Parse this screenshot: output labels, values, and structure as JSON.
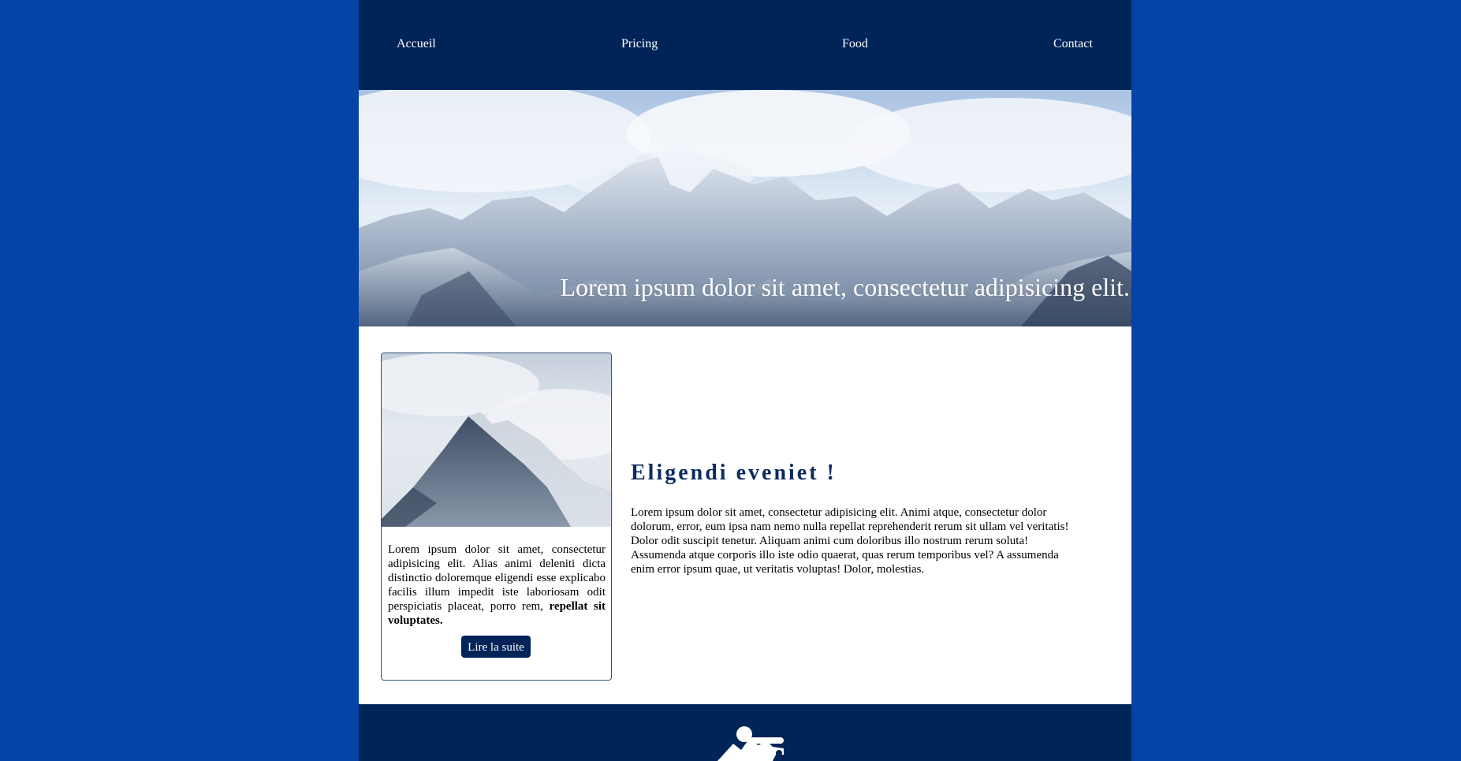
{
  "nav": {
    "items": [
      {
        "label": "Accueil"
      },
      {
        "label": "Pricing"
      },
      {
        "label": "Food"
      },
      {
        "label": "Contact"
      }
    ]
  },
  "hero": {
    "caption": "Lorem ipsum dolor sit amet, consectetur adipisicing elit."
  },
  "card": {
    "text": "Lorem ipsum dolor sit amet, consectetur adipisicing elit. Alias animi deleniti dicta distinctio doloremque eligendi esse explicabo facilis illum impedit iste laboriosam odit perspiciatis placeat, porro rem,",
    "bold_text": "repellat sit voluptates.",
    "button_label": "Lire la suite"
  },
  "article": {
    "title": "Eligendi eveniet !",
    "body": "Lorem ipsum dolor sit amet, consectetur adipisicing elit. Animi atque, consectetur dolor dolorum, error, eum ipsa nam nemo nulla repellat reprehenderit rerum sit ullam vel veritatis! Dolor odit suscipit tenetur. Aliquam animi cum doloribus illo nostrum rerum soluta! Assumenda atque corporis illo iste odio quaerat, quas rerum temporibus vel? A assumenda enim error ipsum quae, ut veritatis voluptas! Dolor, molestias."
  },
  "colors": {
    "background": "#0443a8",
    "nav_bg": "#002358",
    "title": "#0d2b5e",
    "button_bg": "#002358"
  },
  "icons": {
    "footer_logo": "mountain-logo-icon"
  }
}
